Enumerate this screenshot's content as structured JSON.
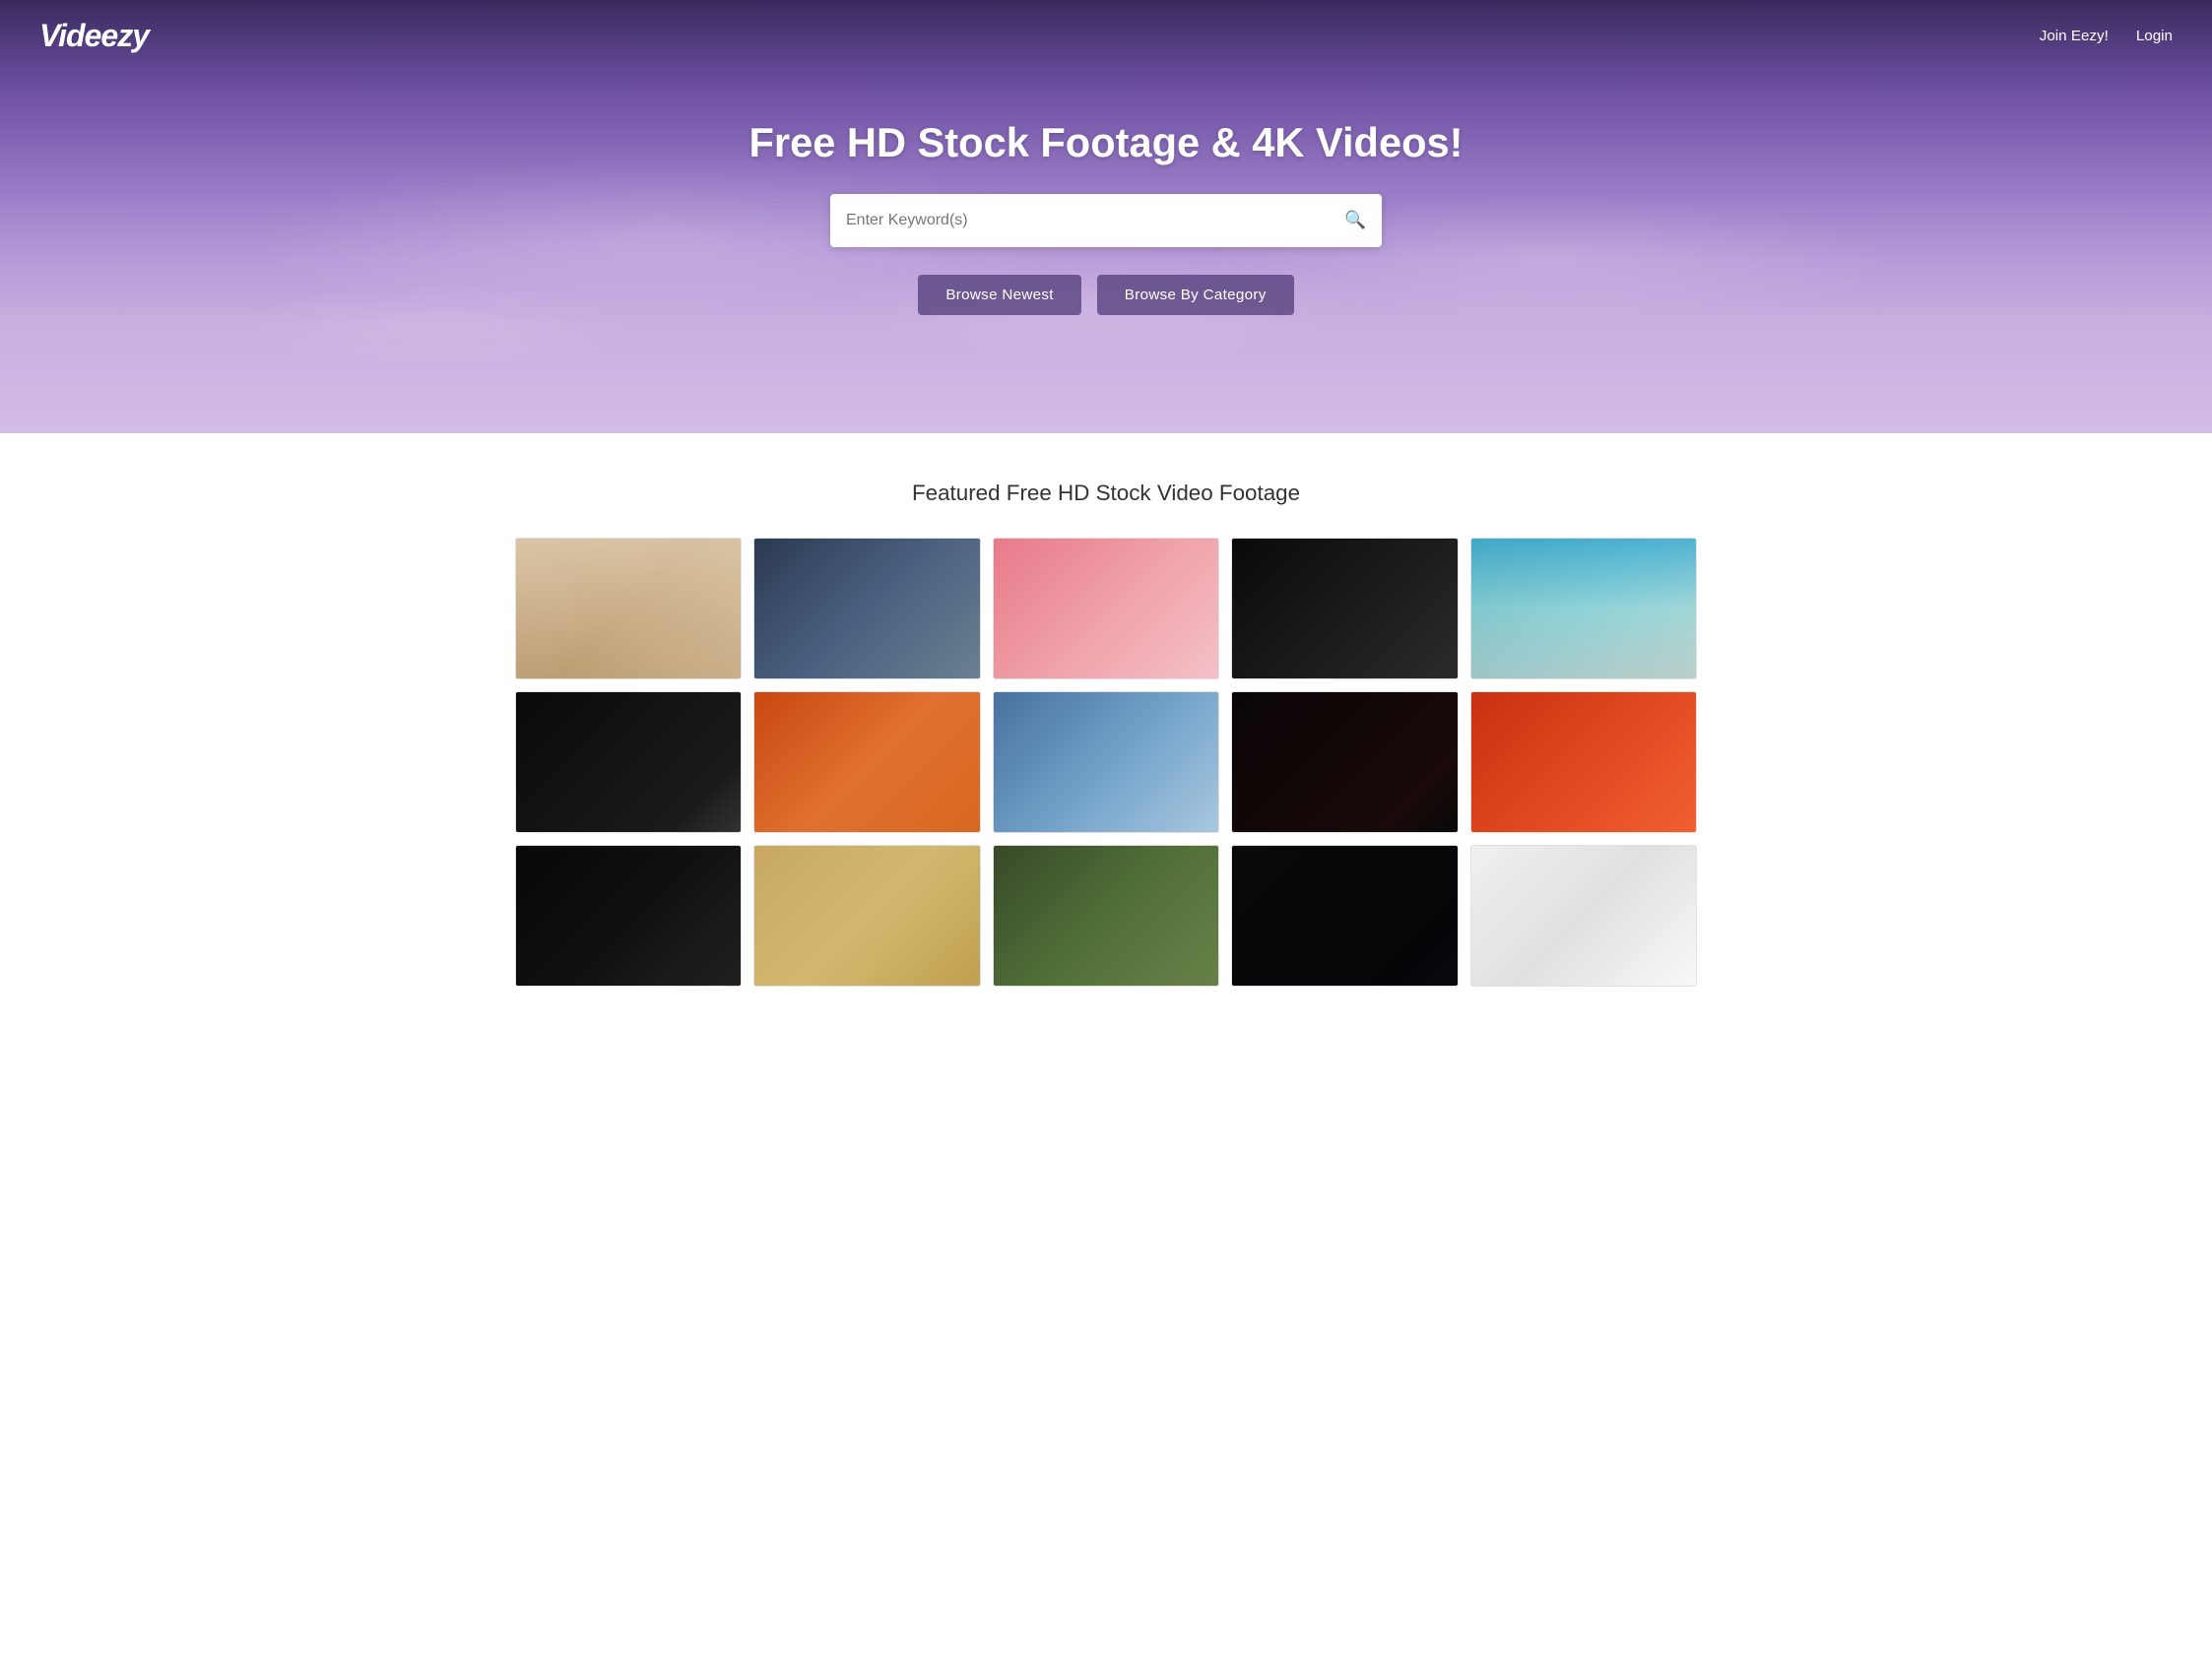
{
  "nav": {
    "logo": "Videezy",
    "links": [
      {
        "label": "Join Eezy!",
        "id": "join"
      },
      {
        "label": "Login",
        "id": "login"
      }
    ]
  },
  "hero": {
    "title": "Free HD Stock Footage & 4K Videos!",
    "search_placeholder": "Enter Keyword(s)",
    "buttons": [
      {
        "label": "Browse Newest",
        "id": "browse-newest"
      },
      {
        "label": "Browse By Category",
        "id": "browse-category"
      }
    ]
  },
  "featured": {
    "title": "Featured Free HD Stock Video Footage",
    "videos": [
      {
        "id": 1,
        "thumb_class": "thumb-1"
      },
      {
        "id": 2,
        "thumb_class": "thumb-2"
      },
      {
        "id": 3,
        "thumb_class": "thumb-3"
      },
      {
        "id": 4,
        "thumb_class": "thumb-4"
      },
      {
        "id": 5,
        "thumb_class": "thumb-5"
      },
      {
        "id": 6,
        "thumb_class": "thumb-6"
      },
      {
        "id": 7,
        "thumb_class": "thumb-7"
      },
      {
        "id": 8,
        "thumb_class": "thumb-8"
      },
      {
        "id": 9,
        "thumb_class": "thumb-9"
      },
      {
        "id": 10,
        "thumb_class": "thumb-10"
      },
      {
        "id": 11,
        "thumb_class": "thumb-11"
      },
      {
        "id": 12,
        "thumb_class": "thumb-12"
      },
      {
        "id": 13,
        "thumb_class": "thumb-13"
      },
      {
        "id": 14,
        "thumb_class": "thumb-14"
      },
      {
        "id": 15,
        "thumb_class": "thumb-15"
      }
    ]
  }
}
